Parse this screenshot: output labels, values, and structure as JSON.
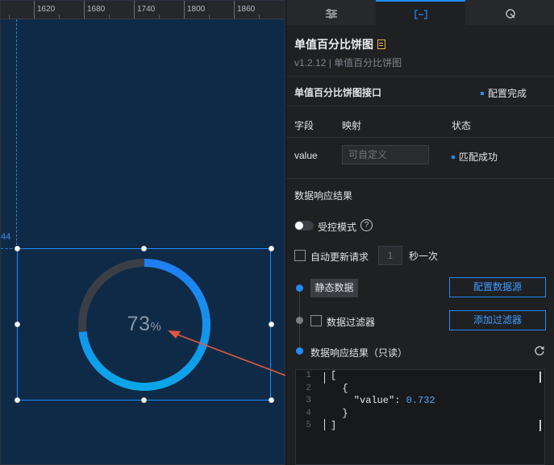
{
  "ruler": {
    "labels": [
      "1620",
      "1680",
      "1740",
      "1800",
      "1860"
    ]
  },
  "guide": {
    "label": "44"
  },
  "widget": {
    "percent": 0.732,
    "display_value": "73",
    "unit": "%",
    "colors": {
      "arc_start": "#0a9be8",
      "arc_end": "#1e84f5",
      "track": "#3a3f47"
    }
  },
  "tabs": [
    {
      "name": "tab-style",
      "icon": "sliders-icon"
    },
    {
      "name": "tab-data",
      "icon": "data-bracket-icon"
    },
    {
      "name": "tab-interaction",
      "icon": "interaction-icon"
    }
  ],
  "header": {
    "title": "单值百分比饼图",
    "version": "v1.2.12 | 单值百分比饼图",
    "doc_icon": "document-icon"
  },
  "api": {
    "title": "单值百分比饼图接口",
    "status": "配置完成"
  },
  "mapping_table": {
    "headers": [
      "字段",
      "映射",
      "状态"
    ],
    "rows": [
      {
        "field": "value",
        "placeholder": "可自定义",
        "status": "匹配成功"
      }
    ]
  },
  "response": {
    "section_title": "数据响应结果",
    "controlled_mode_label": "受控模式",
    "auto_update_label": "自动更新请求",
    "interval_value": "1",
    "interval_unit": "秒一次",
    "static_data_label": "静态数据",
    "configure_source_button": "配置数据源",
    "filter_label": "数据过滤器",
    "add_filter_button": "添加过滤器",
    "result_label": "数据响应结果（只读）"
  },
  "code": {
    "line_numbers": [
      "1",
      "2",
      "3",
      "4",
      "5"
    ],
    "lines": [
      "[",
      "  {",
      "    \"value\": ",
      "  }",
      "]"
    ],
    "value_literal": "0.732"
  },
  "accent_color": "#1f8bff"
}
